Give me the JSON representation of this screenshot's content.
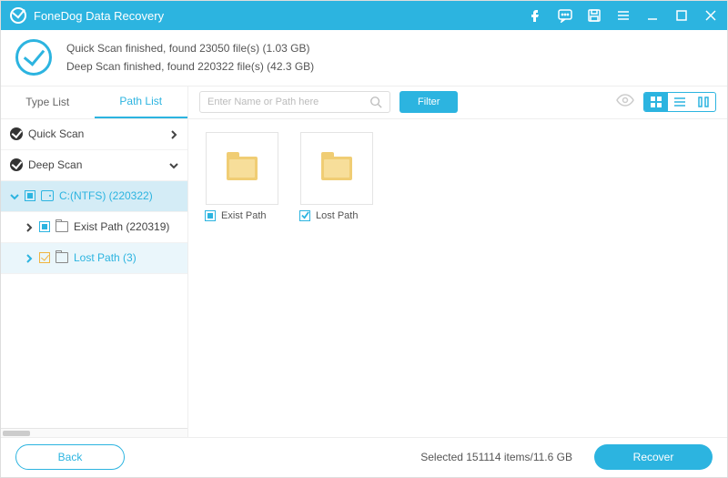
{
  "app_title": "FoneDog Data Recovery",
  "scan": {
    "quick": "Quick Scan finished, found 23050 file(s) (1.03 GB)",
    "deep": "Deep Scan finished, found 220322 file(s) (42.3 GB)"
  },
  "tabs": {
    "type": "Type List",
    "path": "Path List"
  },
  "tree": {
    "quick_scan": "Quick Scan",
    "deep_scan": "Deep Scan",
    "drive": "C:(NTFS) (220322)",
    "exist_path": "Exist Path (220319)",
    "lost_path": "Lost Path (3)"
  },
  "search": {
    "placeholder": "Enter Name or Path here"
  },
  "toolbar": {
    "filter": "Filter"
  },
  "items": {
    "exist": "Exist Path",
    "lost": "Lost Path"
  },
  "footer": {
    "back": "Back",
    "status": "Selected 151114 items/11.6 GB",
    "recover": "Recover"
  }
}
